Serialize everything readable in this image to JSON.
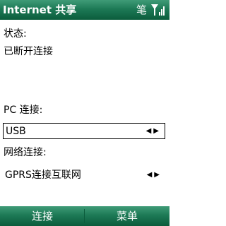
{
  "title_bar": {
    "title": "Internet 共享",
    "ime_indicator": "笔",
    "signal_icon": "signal-strength-icon"
  },
  "status": {
    "label": "状态:",
    "value": "已断开连接"
  },
  "pc_connection": {
    "label": "PC 连接:",
    "value": "USB",
    "arrows": "◀▶"
  },
  "network_connection": {
    "label": "网络连接:",
    "value": "GPRS连接互联网",
    "arrows": "◀▶"
  },
  "softkeys": {
    "left": "连接",
    "right": "菜单"
  },
  "colors": {
    "bar": "#1d7a56",
    "background": "#ffffff"
  }
}
